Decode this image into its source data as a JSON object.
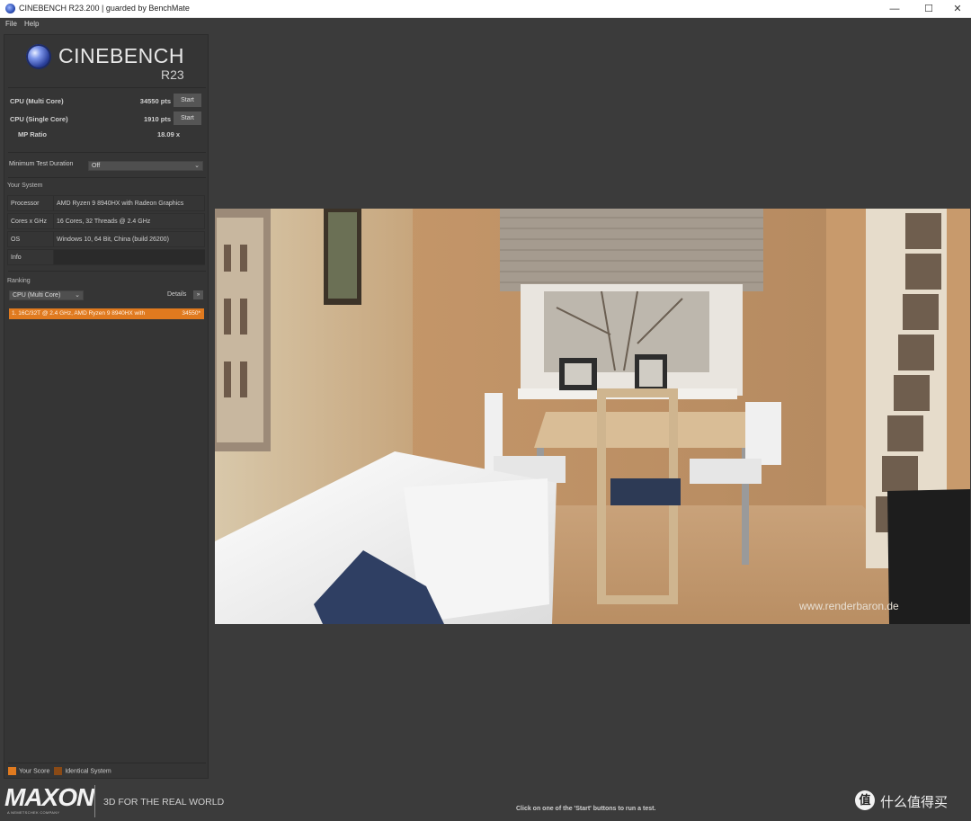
{
  "window": {
    "title": "CINEBENCH R23.200 | guarded by BenchMate",
    "minimize_glyph": "—",
    "maximize_glyph": "☐",
    "close_glyph": "✕"
  },
  "menu": [
    "File",
    "Help"
  ],
  "logo": {
    "name": "CINEBENCH",
    "version": "R23"
  },
  "scores": {
    "multi": {
      "label": "CPU (Multi Core)",
      "value": "34550 pts",
      "button": "Start"
    },
    "single": {
      "label": "CPU (Single Core)",
      "value": "1910 pts",
      "button": "Start"
    },
    "ratio": {
      "label": "MP Ratio",
      "value": "18.09 x"
    }
  },
  "min_test": {
    "label": "Minimum Test Duration",
    "value": "Off"
  },
  "your_system": {
    "title": "Your System",
    "rows": [
      {
        "key": "Processor",
        "value": "AMD Ryzen 9 8940HX with Radeon Graphics"
      },
      {
        "key": "Cores x GHz",
        "value": "16 Cores, 32 Threads @ 2.4 GHz"
      },
      {
        "key": "OS",
        "value": "Windows 10, 64 Bit, China (build 26200)"
      },
      {
        "key": "Info",
        "value": ""
      }
    ]
  },
  "ranking": {
    "title": "Ranking",
    "select": "CPU (Multi Core)",
    "details": "Details",
    "details_btn": "»",
    "items": [
      {
        "text": "1. 16C/32T @ 2.4 GHz, AMD Ryzen 9 8940HX with",
        "score": "34550*"
      }
    ]
  },
  "legend": {
    "your_score": "Your Score",
    "identical": "Identical System"
  },
  "render_credit": "www.renderbaron.de",
  "branding": {
    "maxon": "MAXON",
    "maxon_sub": "A NEMETSCHEK COMPANY",
    "tagline": "3D FOR THE REAL WORLD"
  },
  "status": "Click on one of the 'Start' buttons to run a test.",
  "watermark": {
    "icon": "值",
    "text": "什么值得买"
  },
  "colors": {
    "accent": "#e07a1f",
    "identical": "#8a4a16",
    "background": "#3b3b3b"
  }
}
